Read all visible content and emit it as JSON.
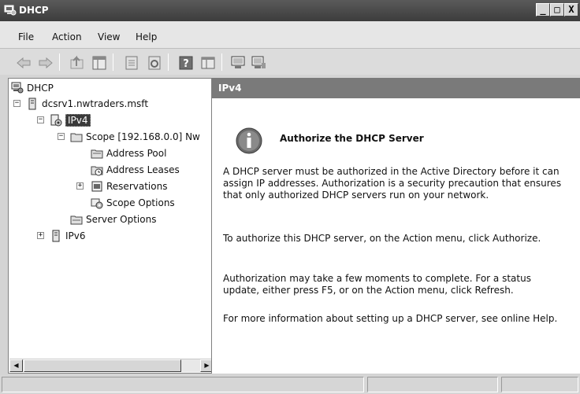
{
  "window": {
    "title": "DHCP",
    "buttons": {
      "minimize": "_",
      "maximize": "□",
      "close": "X"
    }
  },
  "menu": {
    "items": [
      {
        "label": "File"
      },
      {
        "label": "Action"
      },
      {
        "label": "View"
      },
      {
        "label": "Help"
      }
    ]
  },
  "toolbar": {
    "icons": [
      "back-arrow-icon",
      "forward-arrow-icon",
      "up-folder-icon",
      "show-hide-tree-icon",
      "properties-icon",
      "refresh-icon",
      "help-icon",
      "export-list-icon",
      "server-icon",
      "server-add-icon"
    ]
  },
  "tree": {
    "root": "DHCP",
    "server": "dcsrv1.nwtraders.msft",
    "ipv4": "IPv4",
    "scope": "Scope [192.168.0.0] Nw",
    "address_pool": "Address Pool",
    "address_leases": "Address Leases",
    "reservations": "Reservations",
    "scope_options": "Scope Options",
    "server_options": "Server Options",
    "ipv6": "IPv6"
  },
  "content": {
    "header": "IPv4",
    "title": "Authorize the DHCP Server",
    "p1": "A DHCP server must be authorized in the Active Directory before it can assign IP addresses. Authorization is a security precaution that ensures that only authorized DHCP servers run on your network.",
    "p2": "To authorize this DHCP server, on the Action menu, click Authorize.",
    "p3": "Authorization may take a few moments to complete. For a status update, either press F5, or on the Action menu, click Refresh.",
    "p4": "For more information about setting up a DHCP server, see online Help."
  },
  "status": {
    "cells": [
      "",
      "",
      ""
    ]
  }
}
